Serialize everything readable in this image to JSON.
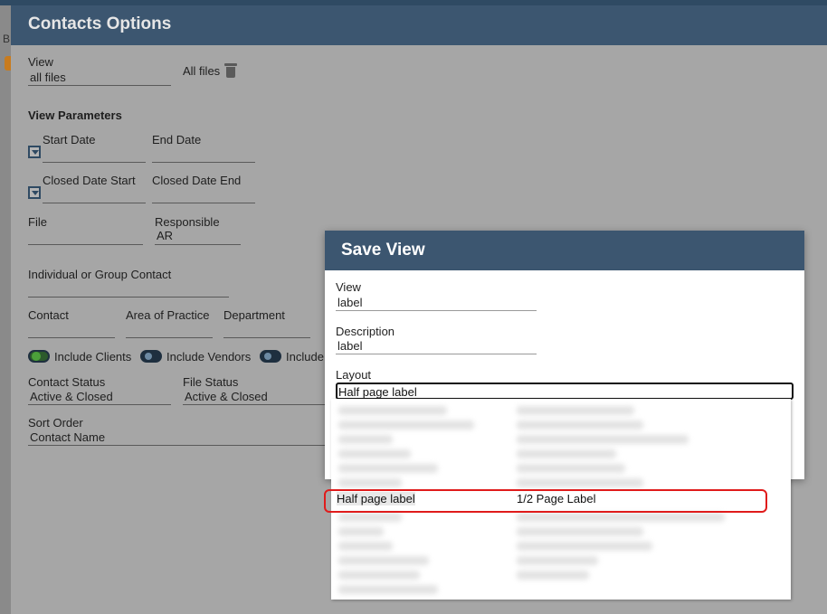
{
  "background": {
    "left_letter": "B"
  },
  "contacts_options": {
    "title": "Contacts Options",
    "view_label": "View",
    "view_value": "all files",
    "view_link": "All files",
    "section_title": "View Parameters",
    "start_date_label": "Start Date",
    "end_date_label": "End Date",
    "closed_date_start_label": "Closed Date Start",
    "closed_date_end_label": "Closed Date End",
    "file_label": "File",
    "responsible_label": "Responsible",
    "responsible_value": "AR",
    "individual_group_label": "Individual or Group Contact",
    "contact_label": "Contact",
    "area_of_practice_label": "Area of Practice",
    "department_label": "Department",
    "include_clients": "Include Clients",
    "include_vendors": "Include Vendors",
    "include_other": "Include",
    "contact_status_label": "Contact Status",
    "contact_status_value": "Active & Closed",
    "file_status_label": "File Status",
    "file_status_value": "Active & Closed",
    "sort_order_label": "Sort Order",
    "sort_order_value": "Contact Name"
  },
  "save_view": {
    "title": "Save View",
    "view_label": "View",
    "view_value": "label",
    "description_label": "Description",
    "description_value": "label",
    "layout_label": "Layout",
    "layout_value": "Half page label"
  },
  "dropdown": {
    "selected_name": "Half page label",
    "selected_description": "1/2 Page Label"
  },
  "colors": {
    "header_bg": "#3c5670",
    "highlight_border": "#e01b1b",
    "toggle_on": "#4ba03a"
  }
}
